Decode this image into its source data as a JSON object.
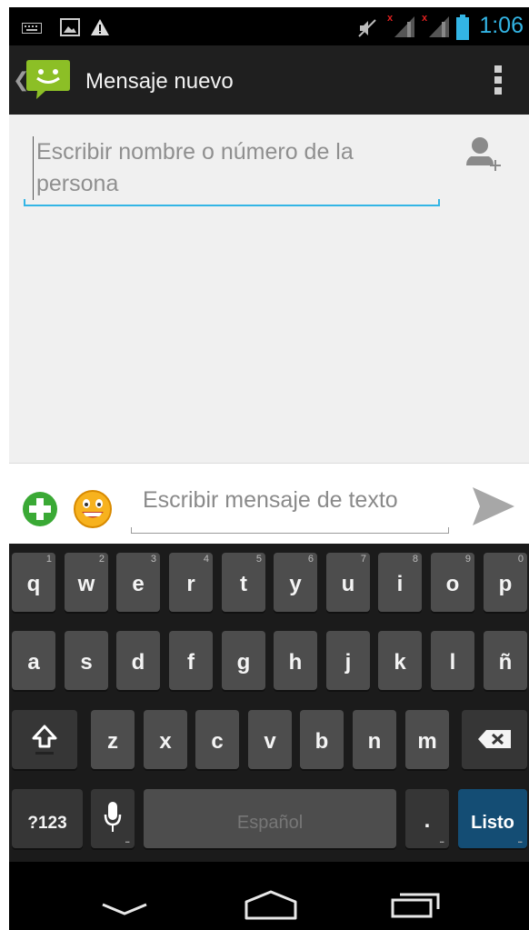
{
  "status_bar": {
    "time": "1:06",
    "icons": [
      "keyboard-icon",
      "image-icon",
      "warning-icon",
      "mute-icon",
      "signal-no-sim-icon",
      "signal-no-sim-icon",
      "battery-icon"
    ],
    "time_color": "#33b5e5"
  },
  "action_bar": {
    "title": "Mensaje nuevo",
    "app_icon": "messaging-smiley-icon",
    "overflow_icon": "overflow-menu-icon"
  },
  "recipient": {
    "placeholder": "Escribir nombre o número de la persona",
    "add_contact_icon": "add-contact-icon",
    "accent": "#33b5e5"
  },
  "compose": {
    "placeholder": "Escribir mensaje de texto",
    "attach_icon": "add-attachment-icon",
    "emoji_icon": "smiley-emoji-icon",
    "send_icon": "send-icon"
  },
  "keyboard": {
    "row1": [
      {
        "k": "q",
        "h": "1"
      },
      {
        "k": "w",
        "h": "2"
      },
      {
        "k": "e",
        "h": "3"
      },
      {
        "k": "r",
        "h": "4"
      },
      {
        "k": "t",
        "h": "5"
      },
      {
        "k": "y",
        "h": "6"
      },
      {
        "k": "u",
        "h": "7"
      },
      {
        "k": "i",
        "h": "8"
      },
      {
        "k": "o",
        "h": "9"
      },
      {
        "k": "p",
        "h": "0"
      }
    ],
    "row2": [
      "a",
      "s",
      "d",
      "f",
      "g",
      "h",
      "j",
      "k",
      "l",
      "ñ"
    ],
    "row3": [
      "z",
      "x",
      "c",
      "v",
      "b",
      "n",
      "m"
    ],
    "symbols_label": "?123",
    "space_label": "Español",
    "period_label": ".",
    "done_label": "Listo",
    "shift_icon": "shift-icon",
    "backspace_icon": "backspace-icon",
    "mic_icon": "microphone-icon"
  },
  "nav_bar": {
    "back_icon": "back-chevron-icon",
    "home_icon": "home-icon",
    "recents_icon": "recent-apps-icon"
  }
}
